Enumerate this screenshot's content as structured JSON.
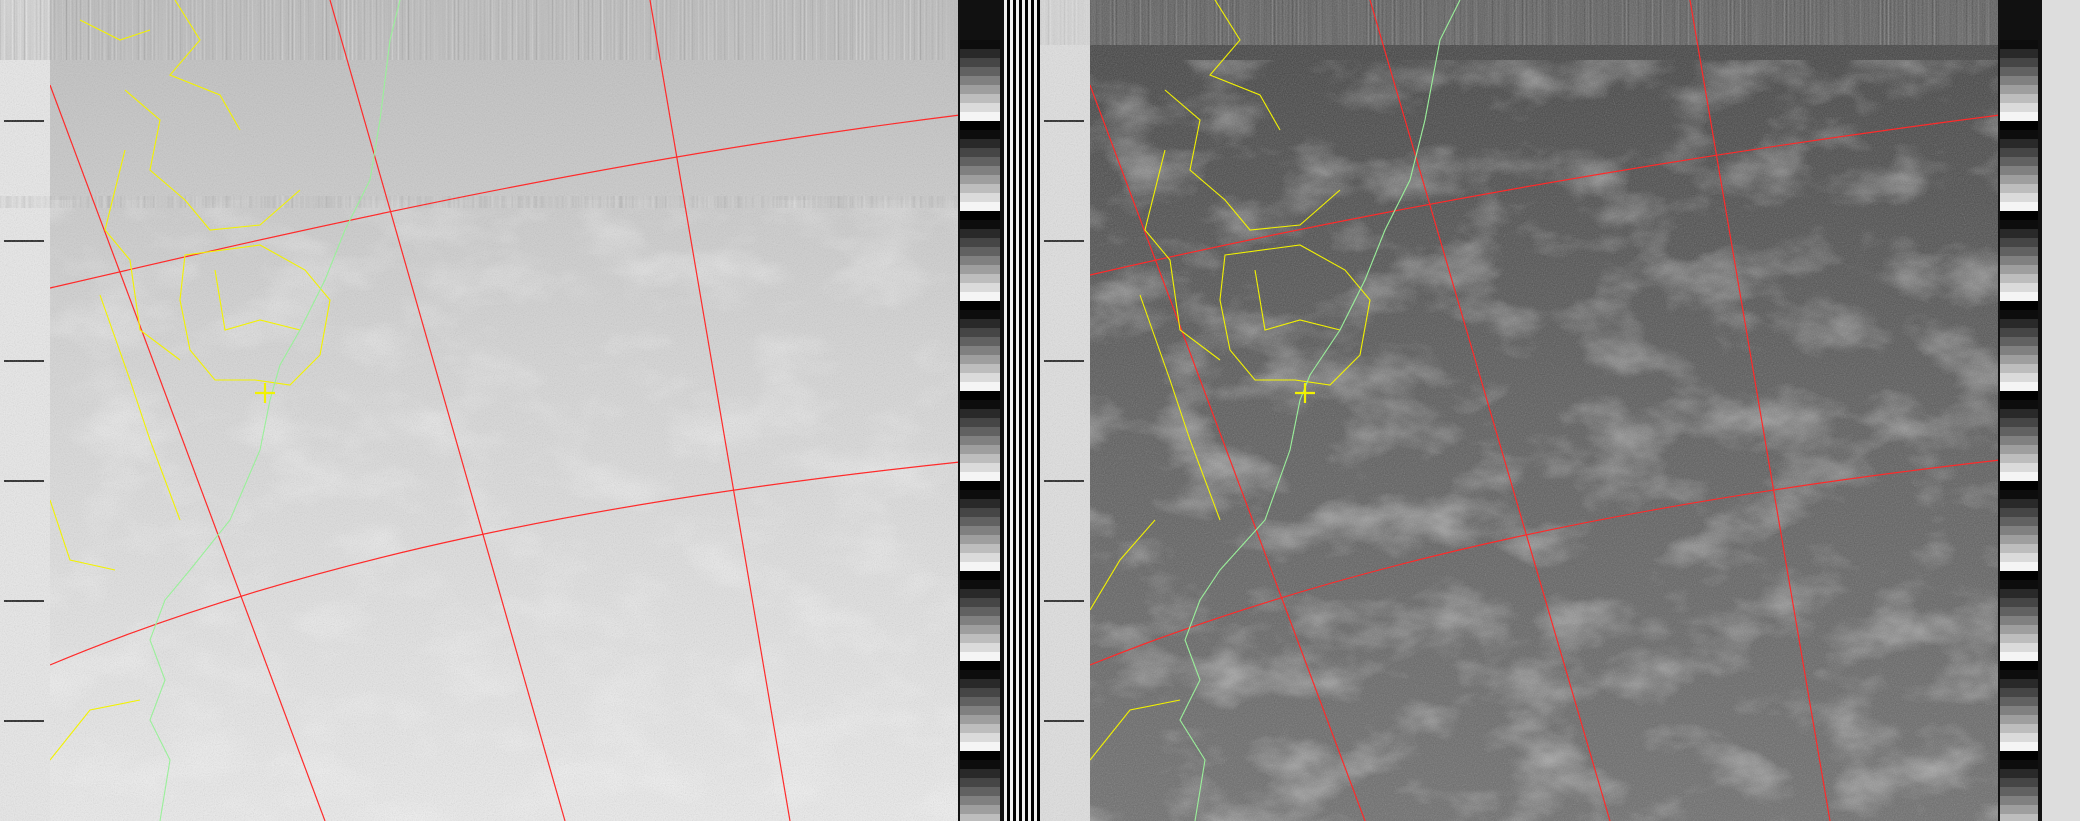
{
  "image": {
    "kind": "NOAA APT satellite image",
    "channels": [
      {
        "name": "channel-a-visible",
        "tone": "bright"
      },
      {
        "name": "channel-b-infrared",
        "tone": "dark"
      }
    ]
  },
  "overlay_colors": {
    "graticule": "#ff2a2a",
    "borders": "#f2f200",
    "coastline": "#9af09a",
    "city_marker": "#f2f200"
  },
  "sync_wedge_levels": [
    0.05,
    0.16,
    0.27,
    0.38,
    0.5,
    0.62,
    0.74,
    0.86,
    0.96,
    0.0
  ]
}
